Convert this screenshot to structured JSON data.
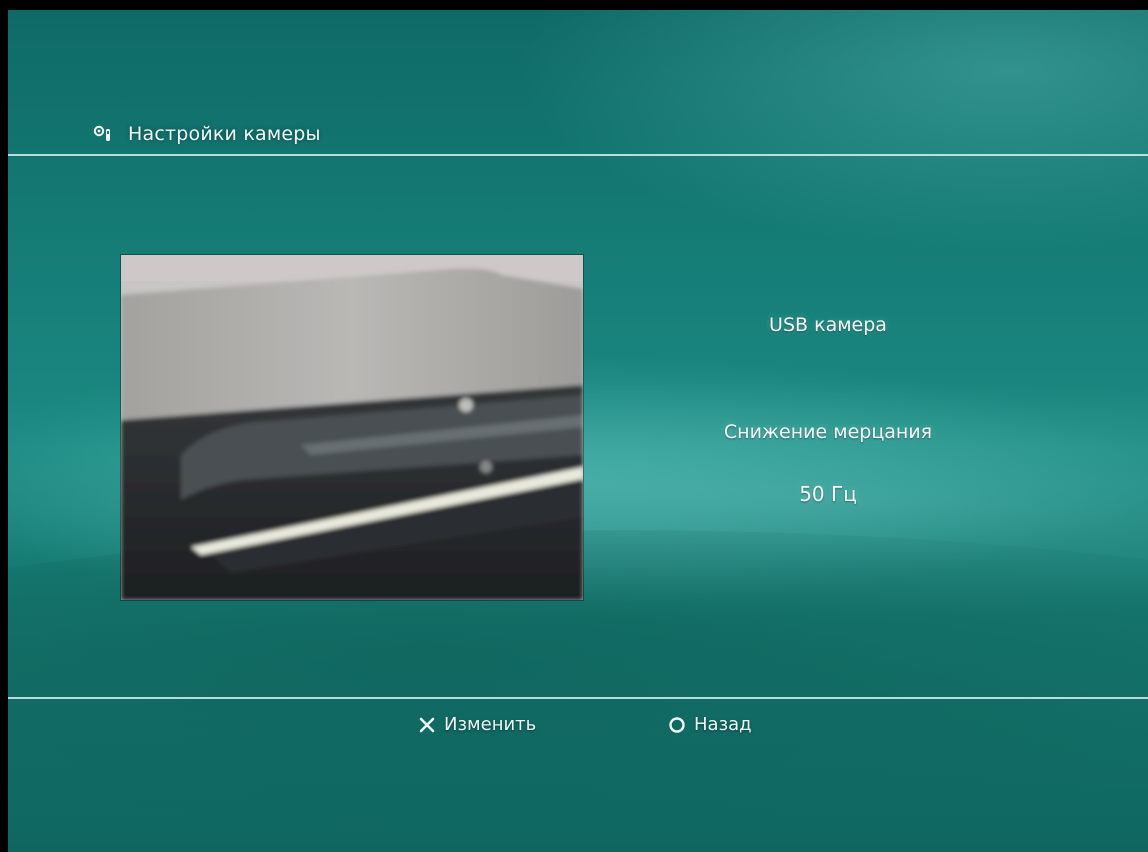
{
  "header": {
    "icon": "camera-icon",
    "title": "Настройки камеры"
  },
  "preview": {
    "icon": "camera-feed-image"
  },
  "info": {
    "camera_name": "USB камера",
    "flicker_label": "Снижение мерцания",
    "flicker_value": "50 Гц"
  },
  "footer": {
    "change": {
      "icon": "cross-button-icon",
      "label": "Изменить"
    },
    "back": {
      "icon": "circle-button-icon",
      "label": "Назад"
    }
  },
  "colors": {
    "background": "#178077",
    "rule": "#d7f0ee",
    "text": "#f2f7f6"
  }
}
